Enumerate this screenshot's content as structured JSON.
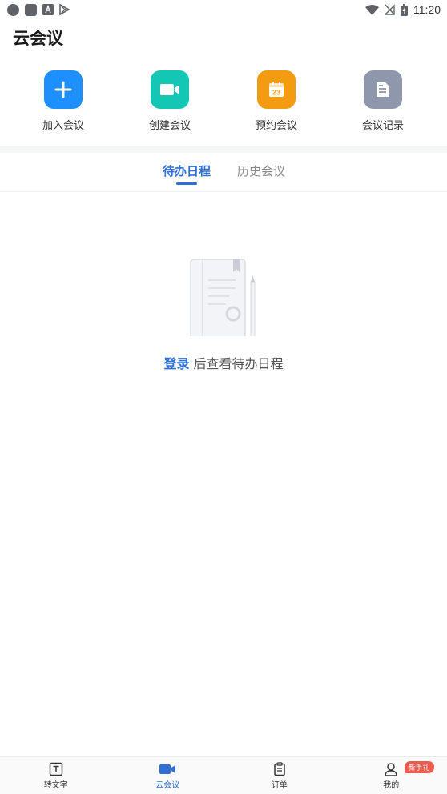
{
  "status_bar": {
    "time": "11:20",
    "left_icons": [
      "circle-icon",
      "square-icon",
      "a-badge-icon",
      "play-store-icon"
    ],
    "right_icons": [
      "wifi-icon",
      "no-signal-icon",
      "battery-charging-icon"
    ]
  },
  "header": {
    "title": "云会议"
  },
  "quick_actions": [
    {
      "label": "加入会议",
      "icon": "plus-icon",
      "color": "#1e8fff"
    },
    {
      "label": "创建会议",
      "icon": "video-camera-icon",
      "color": "#14c7b4"
    },
    {
      "label": "预约会议",
      "icon": "calendar-icon",
      "color": "#f39c12",
      "icon_text": "23"
    },
    {
      "label": "会议记录",
      "icon": "document-icon",
      "color": "#8e97ab"
    }
  ],
  "tabs": [
    {
      "label": "待办日程",
      "active": true
    },
    {
      "label": "历史会议",
      "active": false
    }
  ],
  "empty_state": {
    "link_text": "登录",
    "text": " 后查看待办日程",
    "icon": "notebook-pencil-icon"
  },
  "bottom_nav": {
    "items": [
      {
        "label": "转文字",
        "icon": "text-box-icon",
        "active": false
      },
      {
        "label": "云会议",
        "icon": "video-camera-icon",
        "active": true
      },
      {
        "label": "订单",
        "icon": "clipboard-icon",
        "active": false
      },
      {
        "label": "我的",
        "icon": "person-icon",
        "active": false
      }
    ],
    "badge": "新手礼"
  },
  "colors": {
    "accent": "#2f6fd8",
    "badge": "#f05b4f"
  }
}
